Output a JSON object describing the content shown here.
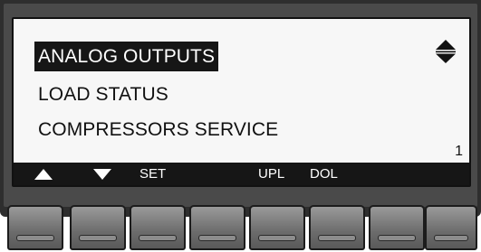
{
  "menu": {
    "items": [
      {
        "label": "ANALOG OUTPUTS",
        "selected": true
      },
      {
        "label": "LOAD STATUS",
        "selected": false
      },
      {
        "label": "COMPRESSORS SERVICE",
        "selected": false
      }
    ],
    "page": "1",
    "scroll_icon": "up-down-arrows-icon"
  },
  "softkeys": {
    "up_icon": "triangle-up-icon",
    "down_icon": "triangle-down-icon",
    "set_label": "SET",
    "upl_label": "UPL",
    "dol_label": "DOL"
  },
  "colors": {
    "screen_bg": "#f7f7f7",
    "selection_bg": "#161616",
    "bezel": "#2e2e2e",
    "button": "#7a7a7a"
  }
}
